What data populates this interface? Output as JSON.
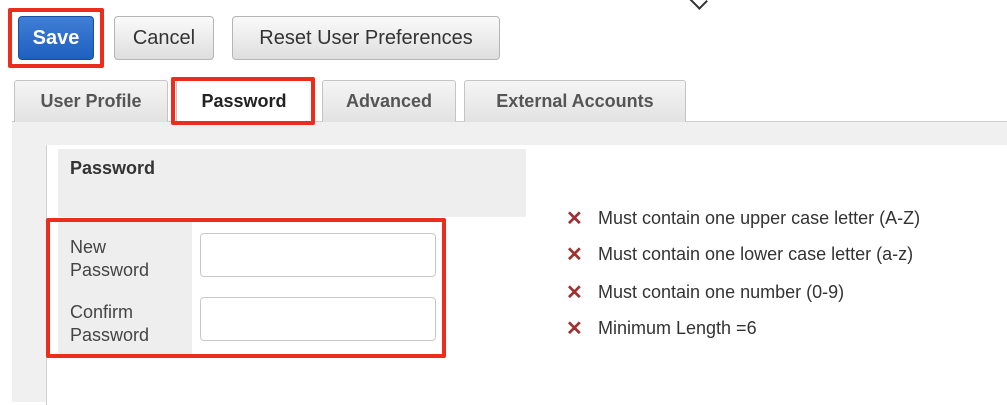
{
  "toolbar": {
    "save_label": "Save",
    "cancel_label": "Cancel",
    "reset_label": "Reset User Preferences"
  },
  "tabs": [
    {
      "label": "User Profile"
    },
    {
      "label": "Password"
    },
    {
      "label": "Advanced"
    },
    {
      "label": "External Accounts"
    }
  ],
  "password_section": {
    "title": "Password",
    "new_password_label": "New Password",
    "confirm_password_label": "Confirm Password",
    "new_password_value": "",
    "confirm_password_value": ""
  },
  "requirements": [
    {
      "icon": "x-icon",
      "text": "Must contain one upper case letter (A-Z)"
    },
    {
      "icon": "x-icon",
      "text": "Must contain one lower case letter (a-z)"
    },
    {
      "icon": "x-icon",
      "text": "Must contain one number (0-9)"
    },
    {
      "icon": "x-icon",
      "text": "Minimum Length =6"
    }
  ],
  "colors": {
    "save_button": "#2d6fd0",
    "highlight": "#ee2c1c",
    "fail_icon": "#a33030"
  }
}
